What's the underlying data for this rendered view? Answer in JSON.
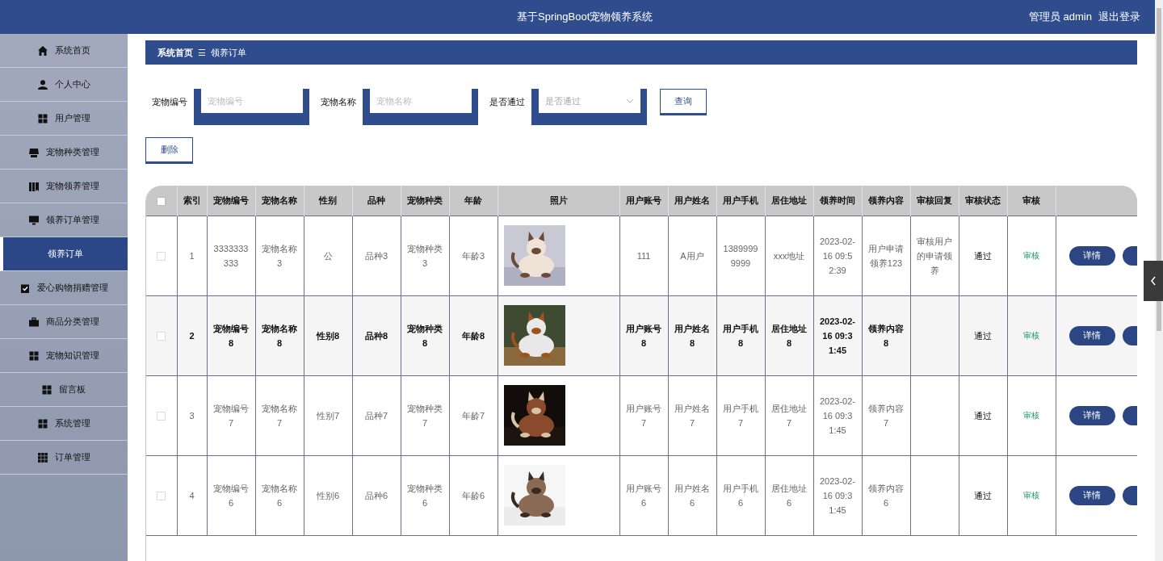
{
  "header": {
    "title": "基于SpringBoot宠物领养系统",
    "user": "管理员 admin",
    "logout": "退出登录"
  },
  "sidebar": {
    "items": [
      {
        "label": "系统首页",
        "kind": "home",
        "selected": false
      },
      {
        "label": "个人中心",
        "kind": "user",
        "selected": false
      },
      {
        "label": "用户管理",
        "kind": "grid",
        "selected": false
      },
      {
        "label": "宠物种类管理",
        "kind": "tray",
        "selected": false
      },
      {
        "label": "宠物领养管理",
        "kind": "book",
        "selected": false
      },
      {
        "label": "领养订单管理",
        "kind": "monitor",
        "selected": false,
        "expanded": true,
        "children": [
          {
            "label": "领养订单",
            "selected": true
          }
        ]
      },
      {
        "label": "爱心购物捐赠管理",
        "kind": "clipboard",
        "selected": false
      },
      {
        "label": "商品分类管理",
        "kind": "briefcase",
        "selected": false
      },
      {
        "label": "宠物知识管理",
        "kind": "grid",
        "selected": false
      },
      {
        "label": "留言板",
        "kind": "grid",
        "selected": false
      },
      {
        "label": "系统管理",
        "kind": "grid",
        "selected": false
      },
      {
        "label": "订单管理",
        "kind": "grid9",
        "selected": false
      }
    ]
  },
  "breadcrumb": {
    "home": "系统首页",
    "separator": "☰",
    "current": "领养订单"
  },
  "filters": [
    {
      "kind": "input",
      "label": "宠物编号",
      "placeholder": "宠物编号"
    },
    {
      "kind": "input",
      "label": "宠物名称",
      "placeholder": "宠物名称"
    },
    {
      "kind": "select",
      "label": "是否通过",
      "placeholder": "是否通过"
    }
  ],
  "query_button": "查询",
  "delete_button": "删除",
  "table": {
    "header_checked": false,
    "columns": [
      {
        "label": "索引",
        "kind": "text"
      },
      {
        "label": "宠物编号",
        "kind": "text"
      },
      {
        "label": "宠物名称",
        "kind": "text"
      },
      {
        "label": "性别",
        "kind": "text"
      },
      {
        "label": "品种",
        "kind": "text"
      },
      {
        "label": "宠物种类",
        "kind": "text"
      },
      {
        "label": "年龄",
        "kind": "text"
      },
      {
        "label": "照片",
        "kind": "picture"
      },
      {
        "label": "用户账号",
        "kind": "text"
      },
      {
        "label": "用户姓名",
        "kind": "text"
      },
      {
        "label": "用户手机",
        "kind": "text"
      },
      {
        "label": "居住地址",
        "kind": "text"
      },
      {
        "label": "领养时间",
        "kind": "text"
      },
      {
        "label": "领养内容",
        "kind": "text"
      },
      {
        "label": "审核回复",
        "kind": "text"
      },
      {
        "label": "审核状态",
        "kind": "status"
      },
      {
        "label": "审核",
        "kind": "link"
      }
    ],
    "rows": [
      {
        "checked": false,
        "highlighted": false,
        "cells": [
          "1",
          "3333333333",
          "宠物名称3",
          "公",
          "品种3",
          "宠物种类3",
          "年龄3",
          "",
          "111",
          "A用户",
          "13899999999",
          "xxx地址",
          "2023-02-16 09:52:39",
          "用户申请领养123",
          "审核用户的申请领养",
          "通过",
          "审核"
        ],
        "detail": "详情"
      },
      {
        "checked": false,
        "highlighted": true,
        "cells": [
          "2",
          "宠物编号8",
          "宠物名称8",
          "性别8",
          "品种8",
          "宠物种类8",
          "年龄8",
          "",
          "用户账号8",
          "用户姓名8",
          "用户手机8",
          "居住地址8",
          "2023-02-16 09:31:45",
          "领养内容8",
          "",
          "通过",
          "审核"
        ],
        "detail": "详情"
      },
      {
        "checked": false,
        "highlighted": false,
        "cells": [
          "3",
          "宠物编号7",
          "宠物名称7",
          "性别7",
          "品种7",
          "宠物种类7",
          "年龄7",
          "",
          "用户账号7",
          "用户姓名7",
          "用户手机7",
          "居住地址7",
          "2023-02-16 09:31:45",
          "领养内容7",
          "",
          "通过",
          "审核"
        ],
        "detail": "详情"
      },
      {
        "checked": false,
        "highlighted": false,
        "cells": [
          "4",
          "宠物编号6",
          "宠物名称6",
          "性别6",
          "品种6",
          "宠物种类6",
          "年龄6",
          "",
          "用户账号6",
          "用户姓名6",
          "用户手机6",
          "居住地址6",
          "2023-02-16 09:31:45",
          "领养内容6",
          "",
          "通过",
          "审核"
        ],
        "detail": "详情"
      }
    ]
  }
}
